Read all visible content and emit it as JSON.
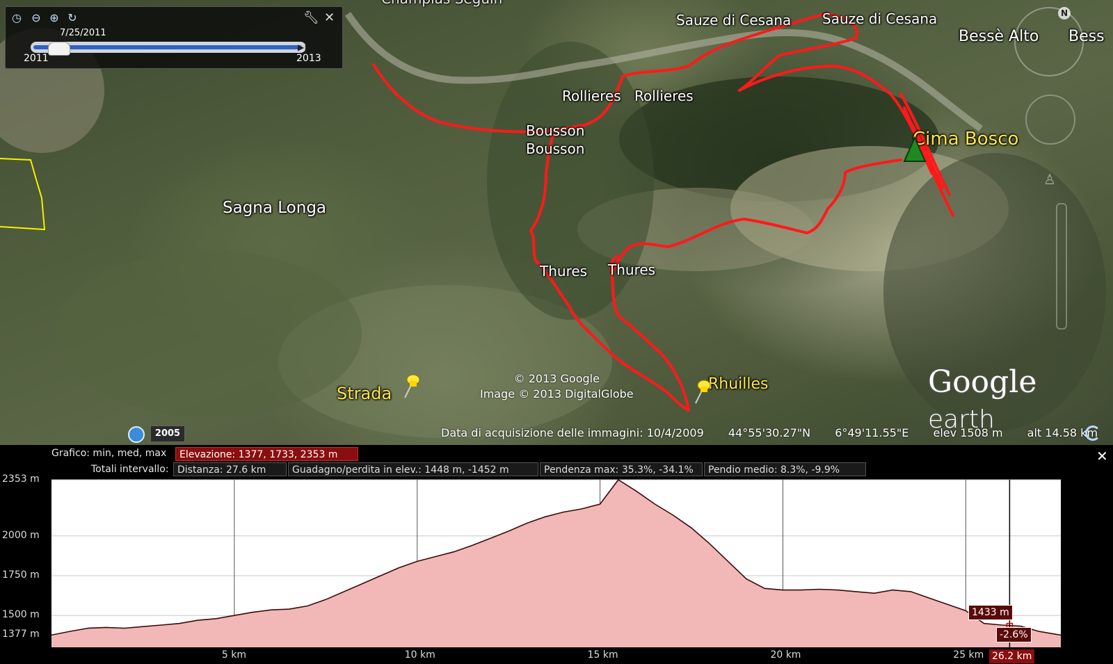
{
  "time_slider": {
    "date": "7/25/2011",
    "start_year": "2011",
    "end_year": "2013",
    "position_fraction": 0.1
  },
  "map": {
    "labels": {
      "sauze_1": "Sauze di Cesana",
      "sauze_2": "Sauze di Cesana",
      "besse_1": "Bessè Alto",
      "besse_2": "Bess",
      "rollieres_1": "Rollieres",
      "rollieres_2": "Rollieres",
      "bousson_1": "Bousson",
      "bousson_2": "Bousson",
      "sagna_longa": "Sagna Longa",
      "thures_1": "Thures",
      "thures_2": "Thures",
      "cima_bosco": "Cima Bosco",
      "strada": "Strada",
      "rhuilles": "Rhuilles",
      "top_cut": "Champlas Seguin"
    },
    "copyright_1": "© 2013 Google",
    "copyright_2": "Image © 2013 DigitalGlobe",
    "logo_1": "Google",
    "logo_2": "earth",
    "historical_year": "2005",
    "compass_n": "N",
    "status": {
      "acquisition": "Data di acquisizione delle immagini: 10/4/2009",
      "lat": "44°55'30.27\"N",
      "lon": "6°49'11.55\"E",
      "elev": "elev  1508 m",
      "alt": "alt  14.58 km"
    },
    "track_color": "#ff1a1a"
  },
  "elevation_panel": {
    "row1_label": "Grafico: min, med, max",
    "elevation_stat": "Elevazione: 1377, 1733, 2353 m",
    "row2_label": "Totali intervallo:",
    "distance_stat": "Distanza: 27.6 km",
    "gain_stat": "Guadagno/perdita in elev.: 1448 m, -1452 m",
    "slope_max_stat": "Pendenza max: 35.3%, -34.1%",
    "slope_avg_stat": "Pendio medio: 8.3%, -9.9%",
    "cursor_value": "1433 m",
    "cursor_gradient": "-2.6%",
    "cursor_km": "26.2 km"
  },
  "chart_data": {
    "type": "area",
    "title": "",
    "xlabel": "",
    "ylabel": "",
    "xlim": [
      0,
      27.6
    ],
    "ylim": [
      1300,
      2353
    ],
    "y_ticks": [
      "2353 m",
      "2000 m",
      "1750 m",
      "1500 m",
      "1377 m"
    ],
    "y_tick_values": [
      2353,
      2000,
      1750,
      1500,
      1377
    ],
    "x_ticks": [
      "5 km",
      "10 km",
      "15 km",
      "20 km",
      "25 km"
    ],
    "x_tick_values": [
      5,
      10,
      15,
      20,
      25
    ],
    "cursor_x": 26.2,
    "fill_color": "#f2b8b8",
    "line_color": "#3a0a0a",
    "x": [
      0,
      0.5,
      1,
      1.5,
      2,
      2.5,
      3,
      3.5,
      4,
      4.5,
      5,
      5.5,
      6,
      6.5,
      7,
      7.5,
      8,
      8.5,
      9,
      9.5,
      10,
      10.5,
      11,
      11.5,
      12,
      12.5,
      13,
      13.5,
      14,
      14.5,
      15,
      15.5,
      16,
      16.5,
      17,
      17.5,
      18,
      18.5,
      19,
      19.5,
      20,
      20.5,
      21,
      21.5,
      22,
      22.5,
      23,
      23.5,
      24,
      24.5,
      25,
      25.5,
      26,
      26.5,
      27,
      27.6
    ],
    "values": [
      1377,
      1400,
      1420,
      1425,
      1420,
      1430,
      1440,
      1450,
      1470,
      1480,
      1500,
      1520,
      1535,
      1540,
      1560,
      1600,
      1650,
      1700,
      1750,
      1800,
      1840,
      1870,
      1900,
      1940,
      1985,
      2030,
      2080,
      2120,
      2150,
      2170,
      2200,
      2353,
      2280,
      2200,
      2130,
      2050,
      1950,
      1840,
      1730,
      1670,
      1660,
      1660,
      1665,
      1660,
      1650,
      1640,
      1660,
      1650,
      1610,
      1570,
      1530,
      1450,
      1440,
      1433,
      1400,
      1377
    ]
  }
}
